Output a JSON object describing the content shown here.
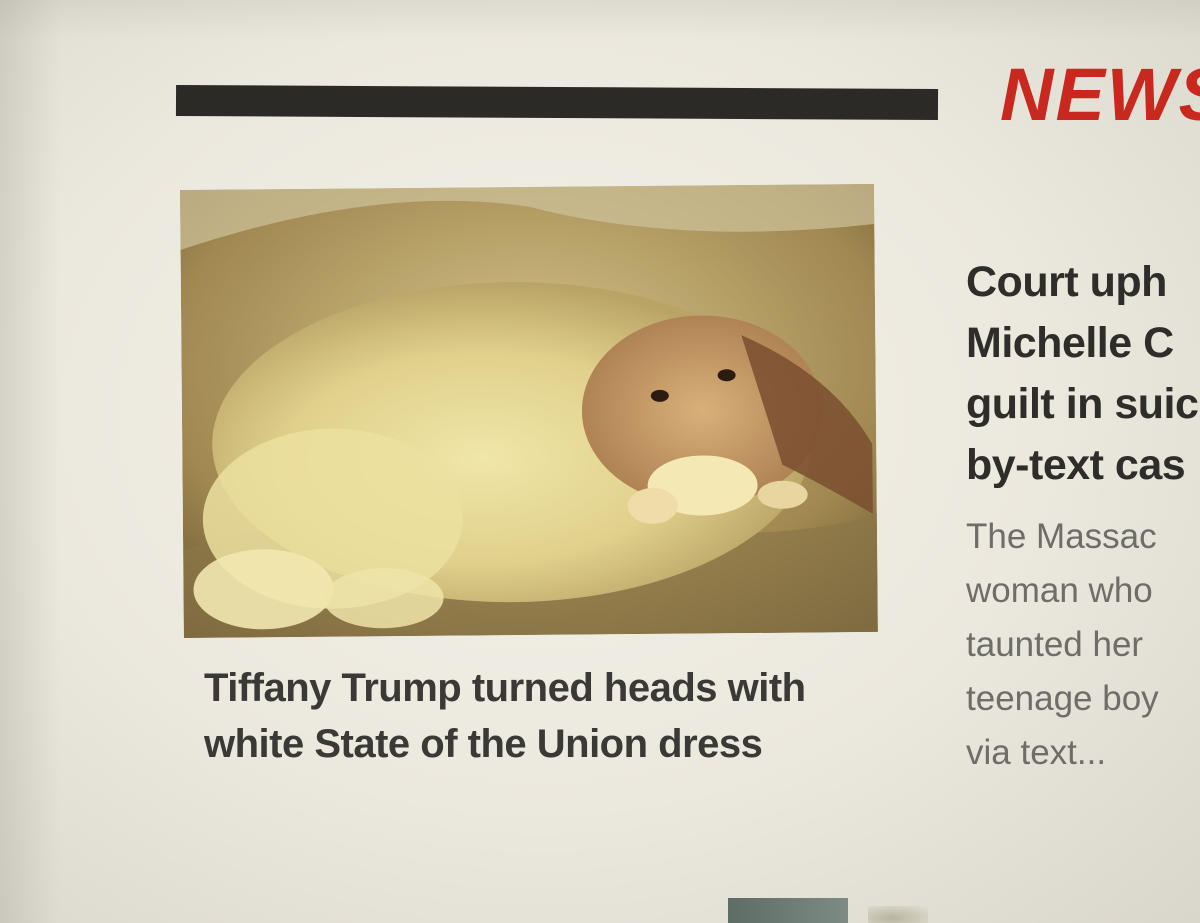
{
  "site": {
    "brand": "NEWS",
    "brand_color": "#c8281e"
  },
  "featured": {
    "image_subject": "dog",
    "headline": "Tiffany Trump turned heads with white State of the Union dress"
  },
  "side_story": {
    "headline_lines": [
      "Court uph",
      "Michelle C",
      "guilt in suic",
      "by-text cas"
    ],
    "summary_lines": [
      "The Massac",
      "woman who",
      "taunted her",
      "teenage boy",
      "via text..."
    ]
  }
}
